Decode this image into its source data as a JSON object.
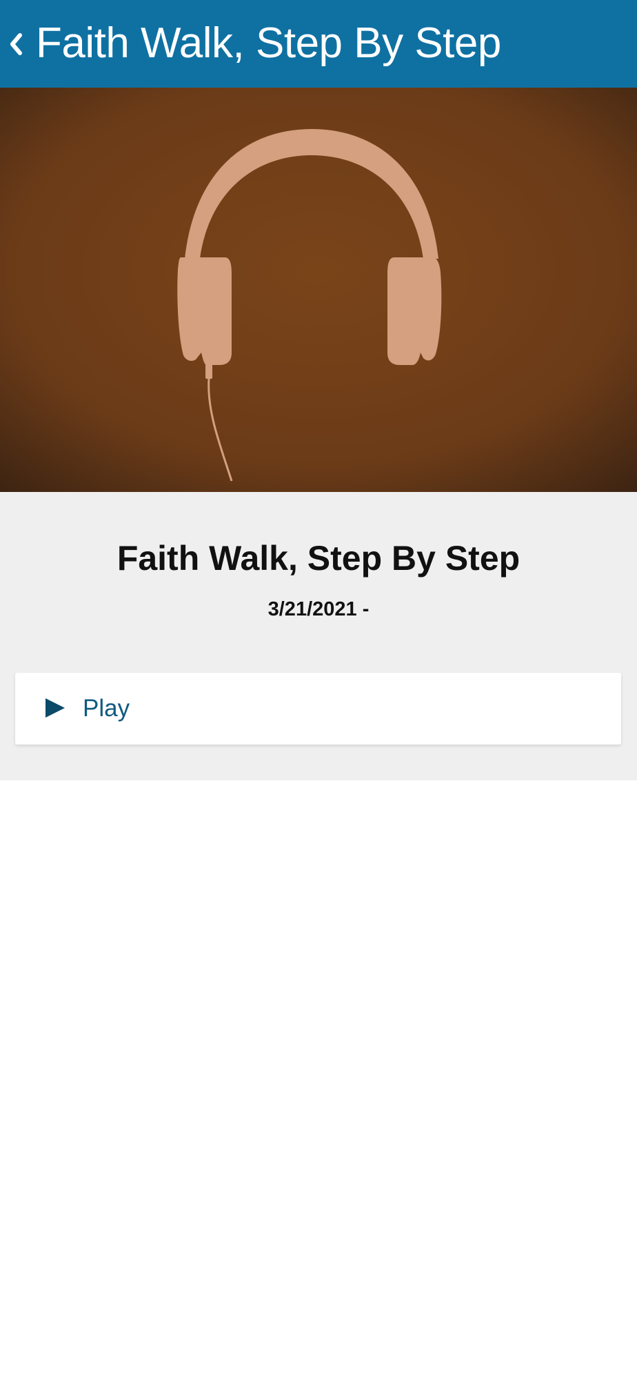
{
  "header": {
    "title": "Faith Walk, Step By Step",
    "back_icon": "chevron-left-icon",
    "background_color": "#0f71a2"
  },
  "hero": {
    "image_subject": "headphones silhouette",
    "background_color": "#6b3d1c",
    "icon_color": "#d4a07f"
  },
  "item": {
    "title": "Faith Walk, Step By Step",
    "date": "3/21/2021 -"
  },
  "actions": {
    "play_label": "Play",
    "play_icon": "play-icon",
    "accent_color": "#0b4a68"
  }
}
